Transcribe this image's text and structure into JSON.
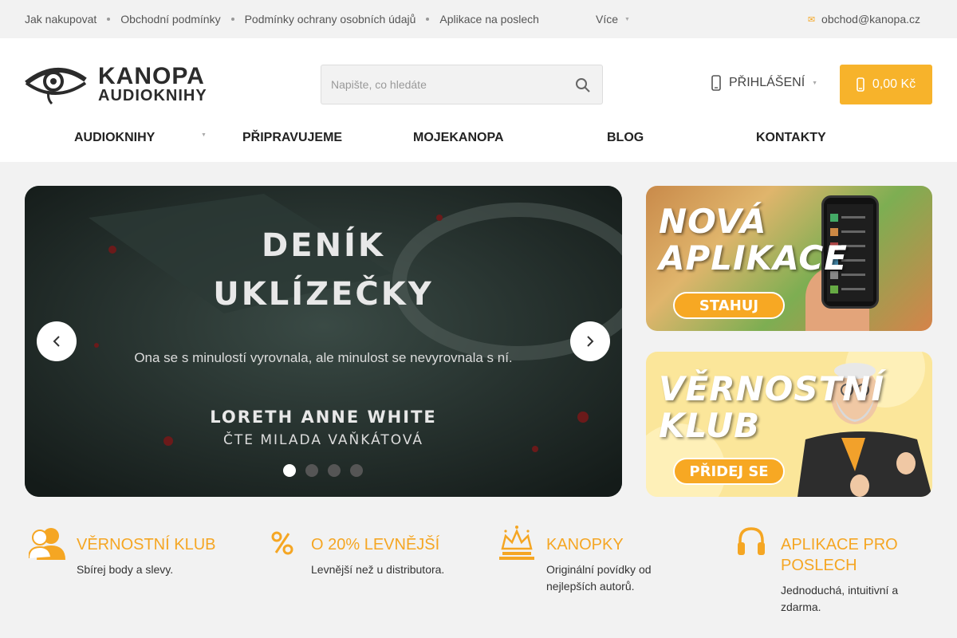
{
  "topbar": {
    "links": [
      "Jak nakupovat",
      "Obchodní podmínky",
      "Podmínky ochrany osobních údajů",
      "Aplikace na poslech"
    ],
    "more_label": "Více",
    "email": "obchod@kanopa.cz"
  },
  "header": {
    "logo_brand": "KANOPA",
    "logo_sub": "AUDIOKNIHY",
    "search_placeholder": "Napište, co hledáte",
    "login_label": "PŘIHLÁŠENÍ",
    "cart_total": "0,00 Kč"
  },
  "nav": {
    "items": [
      "AUDIOKNIHY",
      "PŘIPRAVUJEME",
      "MOJEKANOPA",
      "BLOG",
      "KONTAKTY"
    ]
  },
  "hero": {
    "title_line1": "DENÍK",
    "title_line2": "UKLÍZEČKY",
    "tagline": "Ona se s minulostí vyrovnala, ale minulost se nevyrovnala s ní.",
    "author": "LORETH ANNE WHITE",
    "reader": "ČTE MILADA VAŇKÁTOVÁ",
    "slide_count": 4,
    "active_slide": 1
  },
  "banners": {
    "app": {
      "title_line1": "NOVÁ",
      "title_line2": "APLIKACE",
      "button": "STAHUJ"
    },
    "club": {
      "title_line1": "VĚRNOSTNÍ",
      "title_line2": "KLUB",
      "button": "PŘIDEJ SE"
    }
  },
  "features": [
    {
      "icon": "users-icon",
      "title": "VĚRNOSTNÍ KLUB",
      "text": "Sbírej body a slevy."
    },
    {
      "icon": "percent-icon",
      "title": "O 20% LEVNĚJŠÍ",
      "text": "Levnější než u distributora."
    },
    {
      "icon": "crown-icon",
      "title": "KANOPKY",
      "text": "Originální povídky od nejlepších autorů."
    },
    {
      "icon": "headphones-icon",
      "title": "APLIKACE PRO POSLECH",
      "text": "Jednoduchá, intuitivní a zdarma."
    }
  ],
  "colors": {
    "accent": "#f7b32b",
    "feature_title": "#f5a623",
    "hero_bg": "#1f2826"
  }
}
